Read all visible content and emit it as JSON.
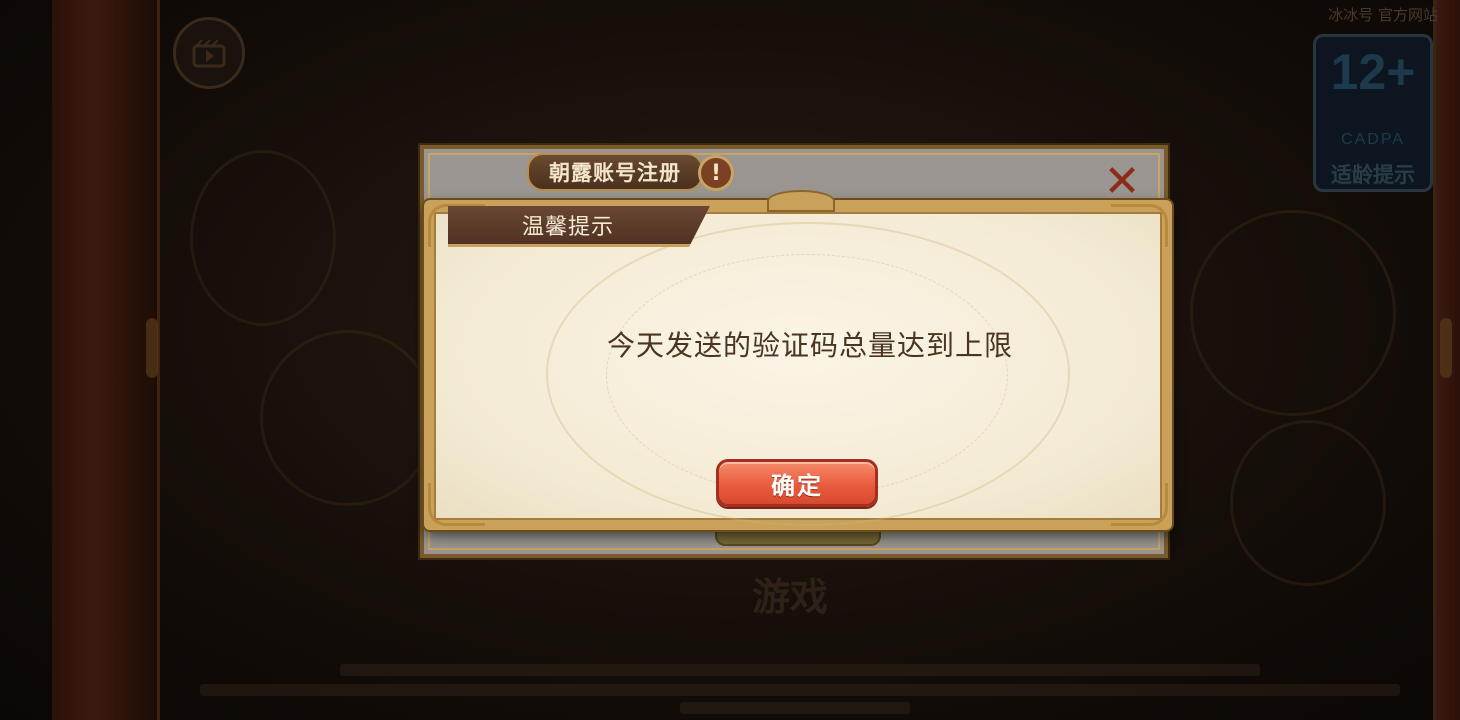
{
  "background": {
    "top_right_text": "冰冰号 官方网站",
    "age_rating": {
      "number": "12+",
      "org": "CADPA",
      "label": "适龄提示"
    },
    "logo_text": "游戏"
  },
  "back_dialog": {
    "title": "朝露账号注册",
    "info_icon_glyph": "!",
    "close_icon_glyph": "✕"
  },
  "dialog": {
    "title": "温馨提示",
    "message": "今天发送的验证码总量达到上限",
    "confirm_label": "确定"
  },
  "colors": {
    "confirm_button": "#ea5c3e",
    "dialog_frame": "#c9a15a",
    "title_tab": "#5a3a28",
    "message_text": "#4a3422"
  }
}
